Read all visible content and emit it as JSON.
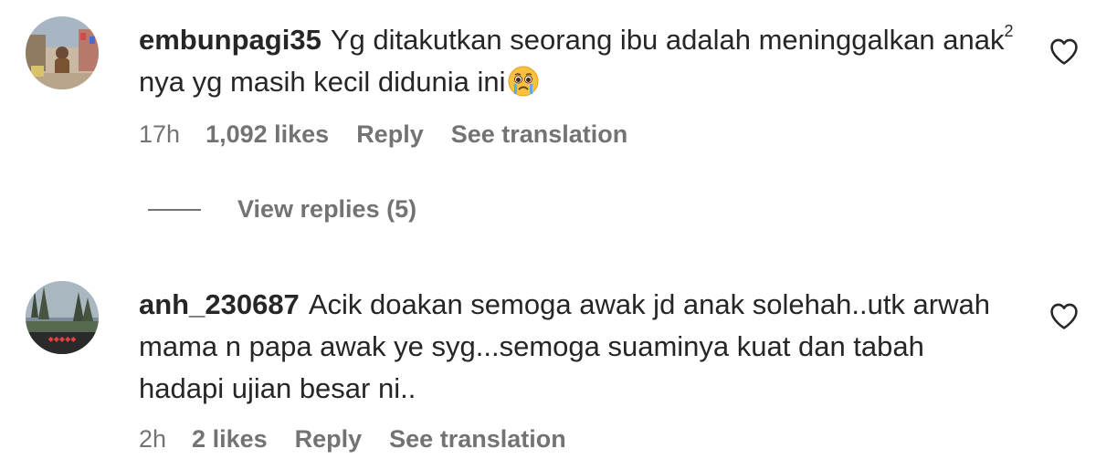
{
  "comments": [
    {
      "username": "embunpagi35",
      "text_part1": "Yg ditakutkan seorang ibu adalah meninggalkan anak",
      "text_sup": "2",
      "text_part2": " nya yg masih kecil didunia ini",
      "emoji": "pleading-crying-face",
      "time": "17h",
      "likes": "1,092 likes",
      "reply_label": "Reply",
      "translate_label": "See translation",
      "view_replies": "View replies (5)"
    },
    {
      "username": "anh_230687",
      "text": "Acik doakan semoga awak jd anak solehah..utk arwah mama n papa awak ye syg...semoga suaminya kuat dan tabah hadapi ujian besar ni..",
      "time": "2h",
      "likes": "2 likes",
      "reply_label": "Reply",
      "translate_label": "See translation"
    }
  ],
  "colors": {
    "text": "#262626",
    "secondary": "#737373",
    "background": "#ffffff"
  },
  "icons": {
    "like": "heart-outline-icon"
  }
}
